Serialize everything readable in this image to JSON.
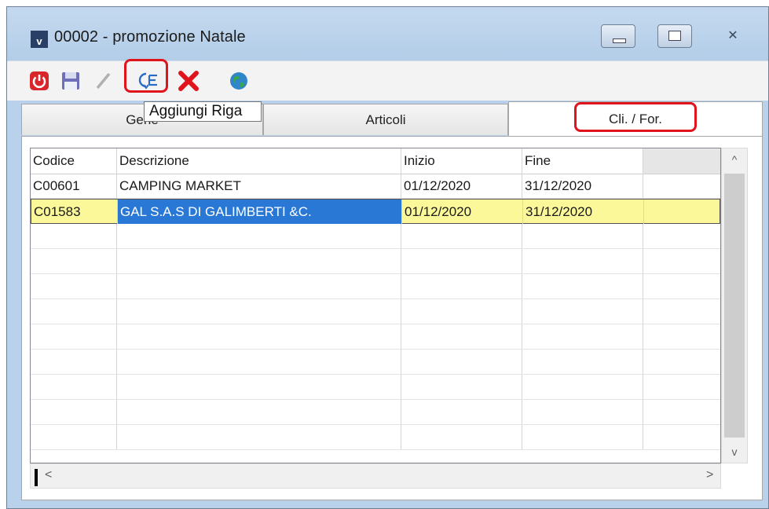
{
  "window": {
    "app_icon_letter": "v",
    "title": "00002 - promozione Natale",
    "minimize_glyph": "▭",
    "maximize_glyph": "□",
    "close_glyph": "✕"
  },
  "toolbar": {
    "tooltip": "Aggiungi Riga",
    "icons": [
      "power-icon",
      "save-icon",
      "pencil-icon",
      "add-row-icon",
      "delete-icon",
      "globe-icon"
    ],
    "colors": {
      "highlight": "#e0141d",
      "power": "#d9262a",
      "save": "#6e6fb8",
      "delete": "#e0141d"
    }
  },
  "tabs": [
    {
      "label": "Gene"
    },
    {
      "label": "Articoli"
    },
    {
      "label": "Cli. / For."
    }
  ],
  "grid": {
    "columns": [
      "Codice",
      "Descrizione",
      "Inizio",
      "Fine"
    ],
    "rows": [
      {
        "codice": "C00601",
        "descrizione": "CAMPING MARKET",
        "inizio": "01/12/2020",
        "fine": "31/12/2020",
        "selected": false
      },
      {
        "codice": "C01583",
        "descrizione": "GAL S.A.S DI GALIMBERTI &C.",
        "inizio": "01/12/2020",
        "fine": "31/12/2020",
        "selected": true
      }
    ],
    "empty_row_count": 9,
    "selection_colors": {
      "row": "#fbf89a",
      "cell": "#2a78d6"
    }
  },
  "scrollbars": {
    "up": "^",
    "down": "v",
    "left": "<",
    "right": ">"
  }
}
